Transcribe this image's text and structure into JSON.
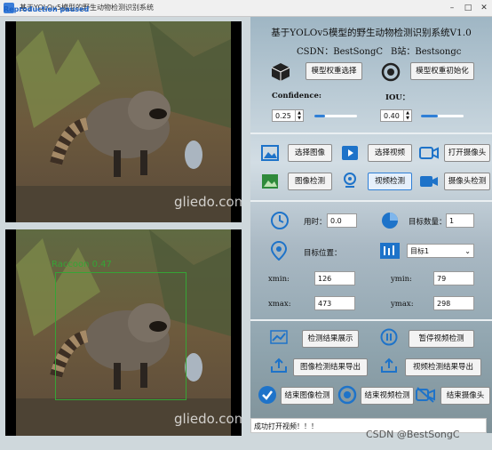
{
  "window": {
    "title": "基于YOLOv5模型的野生动物检测识别系统",
    "overlay_text": "Reproduction paused"
  },
  "images": {
    "watermark": "gliedo.com",
    "detection_label": "Raccoon 0.47"
  },
  "panel": {
    "heading": "基于YOLOv5模型的野生动物检测识别系统V1.0",
    "csdn": "CSDN：BestSongC",
    "bilibili": "B站：Bestsongc",
    "select_weights_label": "模型权重选择",
    "init_weights_label": "模型权重初始化",
    "confidence_label": "Confidence:",
    "confidence_value": "0.25",
    "iou_label": "IOU：",
    "iou_value": "0.40",
    "confidence_level": 0.25,
    "iou_level": 0.4
  },
  "actions": {
    "select_image": "选择图像",
    "select_video": "选择视频",
    "open_camera": "打开摄像头",
    "image_detect": "图像检测",
    "video_detect": "视频检测",
    "camera_detect": "摄像头检测"
  },
  "stats": {
    "time_label": "用时：",
    "time_value": "0.0",
    "count_label": "目标数量：",
    "count_value": "1",
    "position_label": "目标位置：",
    "target_select": "目标1",
    "xmin_label": "xmin:",
    "xmin_value": "126",
    "ymin_label": "ymin:",
    "ymin_value": "79",
    "xmax_label": "xmax:",
    "xmax_value": "473",
    "ymax_label": "ymax:",
    "ymax_value": "298"
  },
  "controls": {
    "show_results": "检测结果展示",
    "pause_video": "暂停视频检测",
    "export_image": "图像检测结果导出",
    "export_video": "视频检测结果导出",
    "end_image": "结束图像检测",
    "end_video": "结束视频检测",
    "end_camera": "结束摄像头"
  },
  "status": {
    "message": "成功打开视频！！！"
  },
  "footer_watermark": "CSDN @BestSongC",
  "colors": {
    "accent": "#2f7fd6",
    "detection": "#36a436"
  }
}
